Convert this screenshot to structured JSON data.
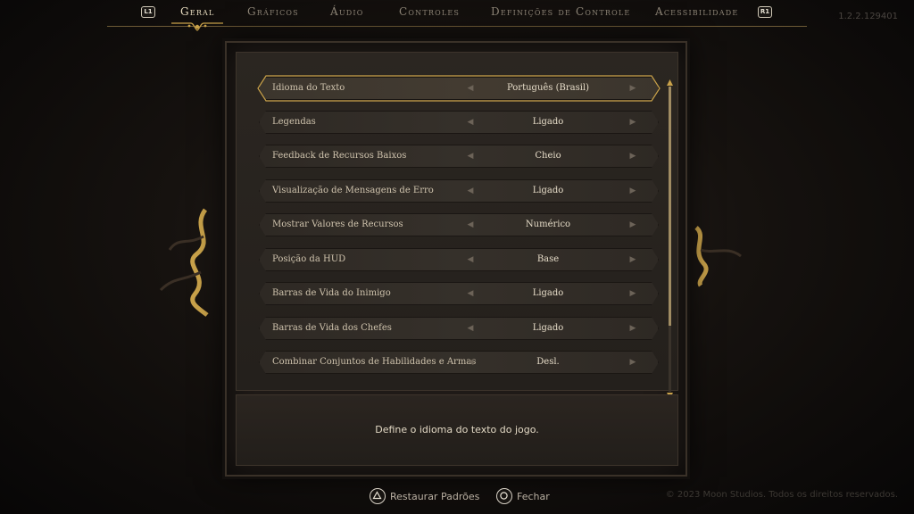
{
  "header": {
    "left_bumper": "L1",
    "right_bumper": "R1",
    "tabs": [
      {
        "label": "Geral"
      },
      {
        "label": "Gráficos"
      },
      {
        "label": "Áudio"
      },
      {
        "label": "Controles"
      },
      {
        "label": "Definições de Controle"
      },
      {
        "label": "Acessibilidade"
      }
    ],
    "version": "1.2.2.129401"
  },
  "settings": [
    {
      "label": "Idioma do Texto",
      "value": "Português (Brasil)"
    },
    {
      "label": "Legendas",
      "value": "Ligado"
    },
    {
      "label": "Feedback de Recursos Baixos",
      "value": "Cheio"
    },
    {
      "label": "Visualização de Mensagens de Erro",
      "value": "Ligado"
    },
    {
      "label": "Mostrar Valores de Recursos",
      "value": "Numérico"
    },
    {
      "label": "Posição da HUD",
      "value": "Base"
    },
    {
      "label": "Barras de Vida do Inimigo",
      "value": "Ligado"
    },
    {
      "label": "Barras de Vida dos Chefes",
      "value": "Ligado"
    },
    {
      "label": "Combinar Conjuntos de Habilidades e Armas",
      "value": "Desl."
    }
  ],
  "description": "Define o idioma do texto do jogo.",
  "footer": {
    "restore_label": "Restaurar Padrões",
    "close_label": "Fechar",
    "copyright": "© 2023 Moon Studios. Todos os direitos reservados."
  },
  "colors": {
    "accent_gold": "#c9a24a",
    "active_tab": "#e8dcc0",
    "inactive_tab": "#8d8476"
  },
  "icons": {
    "left_bumper": "l1-button-icon",
    "right_bumper": "r1-button-icon",
    "restore": "triangle-button-icon",
    "close": "circle-button-icon",
    "arrow_left": "arrow-left-icon",
    "arrow_right": "arrow-right-icon"
  }
}
